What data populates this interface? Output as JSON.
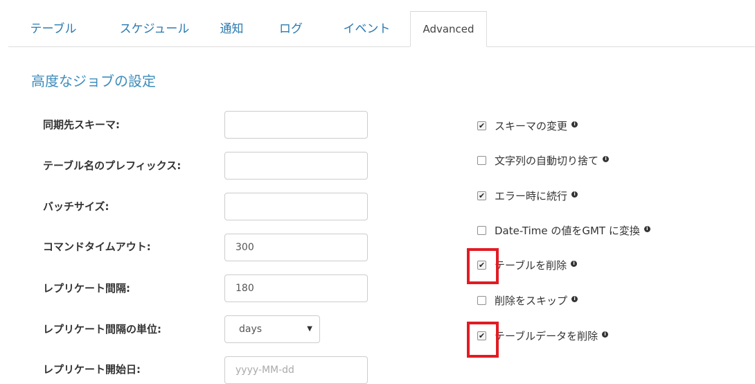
{
  "tabs": [
    {
      "label": "テーブル",
      "active": false
    },
    {
      "label": "スケジュール",
      "active": false
    },
    {
      "label": "通知",
      "active": false
    },
    {
      "label": "ログ",
      "active": false
    },
    {
      "label": "イベント",
      "active": false
    },
    {
      "label": "Advanced",
      "active": true
    }
  ],
  "section_title": "高度なジョブの設定",
  "fields": [
    {
      "label": "同期先スキーマ:",
      "value": "",
      "placeholder": ""
    },
    {
      "label": "テーブル名のプレフィックス:",
      "value": "",
      "placeholder": ""
    },
    {
      "label": "バッチサイズ:",
      "value": "",
      "placeholder": ""
    },
    {
      "label": "コマンドタイムアウト:",
      "value": "300",
      "placeholder": ""
    },
    {
      "label": "レプリケート間隔:",
      "value": "180",
      "placeholder": ""
    },
    {
      "label": "レプリケート間隔の単位:",
      "value": "days",
      "placeholder": ""
    },
    {
      "label": "レプリケート開始日:",
      "value": "",
      "placeholder": "yyyy-MM-dd"
    }
  ],
  "checkboxes": [
    {
      "label": "スキーマの変更",
      "checked": true,
      "info_icon": "info-icon"
    },
    {
      "label": "文字列の自動切り捨て",
      "checked": false,
      "info_icon": "info-icon"
    },
    {
      "label": "エラー時に続行",
      "checked": true,
      "info_icon": "info-icon"
    },
    {
      "label": "Date-Time の値をGMT に変換",
      "checked": false,
      "info_icon": "info-icon"
    },
    {
      "label": "テーブルを削除",
      "checked": true,
      "info_icon": "info-icon"
    },
    {
      "label": "削除をスキップ",
      "checked": false,
      "info_icon": "info-icon"
    },
    {
      "label": "テーブルデータを削除",
      "checked": true,
      "info_icon": "info-icon"
    }
  ],
  "colors": {
    "tab_link": "#2a7ab0",
    "section_title": "#3c8dbc",
    "highlight": "#e21b23"
  }
}
